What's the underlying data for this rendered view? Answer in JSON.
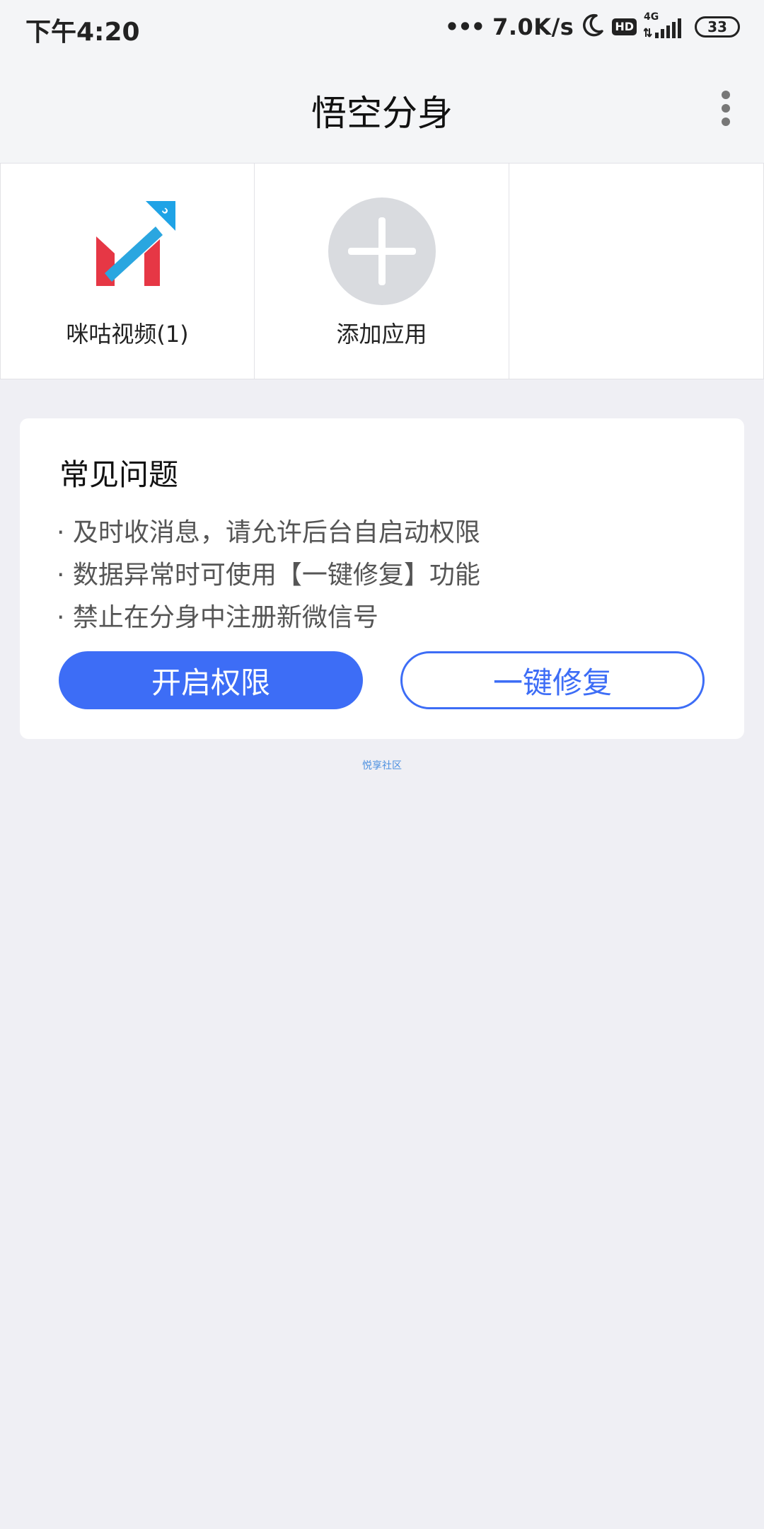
{
  "status_bar": {
    "time": "下午4:20",
    "dots": "•••",
    "net_speed": "7.0K/s",
    "hd": "HD",
    "network": "4G",
    "battery": "33"
  },
  "header": {
    "title": "悟空分身"
  },
  "apps": [
    {
      "label": "咪咕视频(1)"
    },
    {
      "label": "添加应用"
    }
  ],
  "faq": {
    "title": "常见问题",
    "items": [
      "· 及时收消息，请允许后台自启动权限",
      "· 数据异常时可使用【一键修复】功能",
      "· 禁止在分身中注册新微信号"
    ],
    "primary_button": "开启权限",
    "secondary_button": "一键修复"
  },
  "footer": {
    "community": "悦享社区"
  },
  "colors": {
    "accent": "#3d6df6",
    "background": "#efeff4",
    "card": "#ffffff"
  }
}
